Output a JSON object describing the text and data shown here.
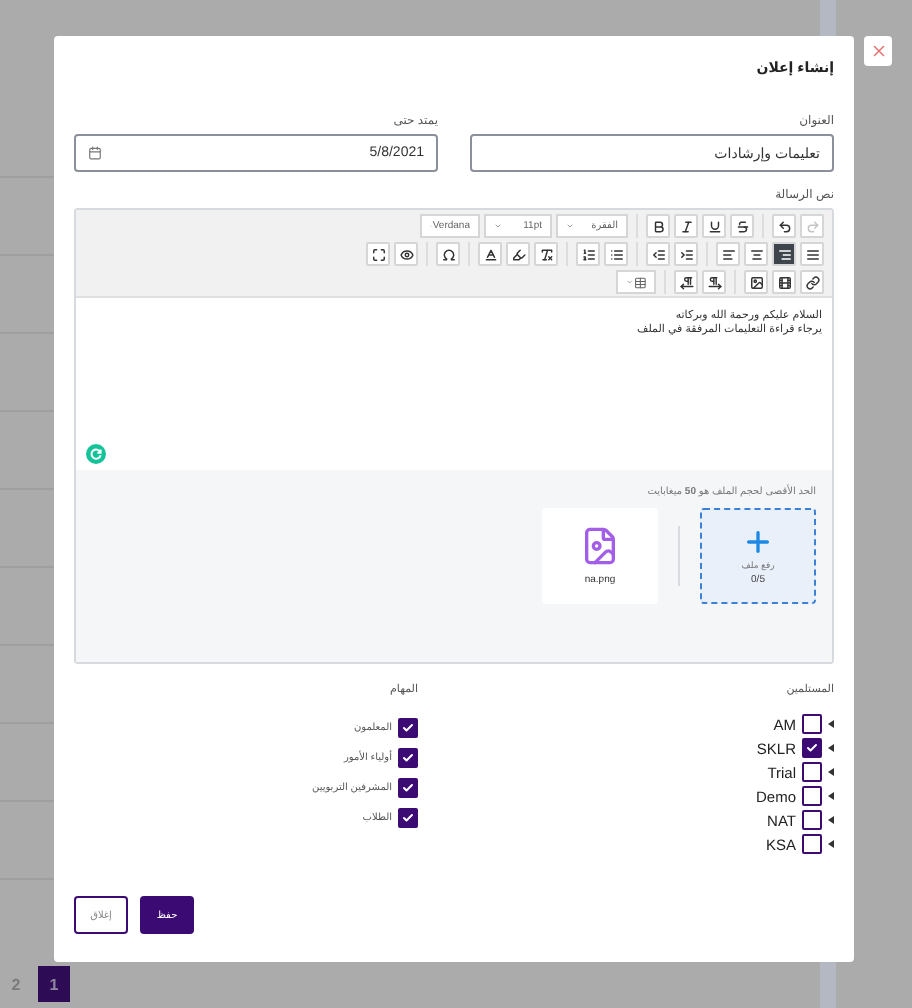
{
  "dialog": {
    "title": "إنشاء إعلان"
  },
  "fields": [
    {
      "label": "العنوان",
      "value": "تعليمات وإرشادات",
      "kind": "text"
    },
    {
      "label": "يمتد حتى",
      "value": "5/8/2021",
      "kind": "date"
    }
  ],
  "message": {
    "label": "نص الرسالة",
    "toolbar": [
      [
        {
          "kind": "redo",
          "disabled": true
        },
        {
          "kind": "undo"
        },
        {
          "kind": "sep"
        },
        {
          "kind": "strike"
        },
        {
          "kind": "underline"
        },
        {
          "kind": "italic"
        },
        {
          "kind": "bold"
        },
        {
          "kind": "sep"
        },
        {
          "kind": "select",
          "value": "الفقرة"
        },
        {
          "kind": "select",
          "value": "11pt"
        },
        {
          "kind": "select",
          "value": "Verdana"
        }
      ],
      [
        {
          "kind": "justify",
          "selected": false
        },
        {
          "kind": "alignright",
          "selected": true
        },
        {
          "kind": "aligncenter",
          "selected": false
        },
        {
          "kind": "alignleft",
          "selected": false
        },
        {
          "kind": "sep"
        },
        {
          "kind": "indent"
        },
        {
          "kind": "outdent"
        },
        {
          "kind": "sep"
        },
        {
          "kind": "ulist"
        },
        {
          "kind": "olist"
        },
        {
          "kind": "sep"
        },
        {
          "kind": "clearformat"
        },
        {
          "kind": "highlight"
        },
        {
          "kind": "fontcolor"
        },
        {
          "kind": "sep"
        },
        {
          "kind": "omega"
        },
        {
          "kind": "sep"
        },
        {
          "kind": "preview"
        },
        {
          "kind": "fullscreen"
        }
      ],
      [
        {
          "kind": "link"
        },
        {
          "kind": "video"
        },
        {
          "kind": "image"
        },
        {
          "kind": "sep"
        },
        {
          "kind": "rtl"
        },
        {
          "kind": "ltr"
        },
        {
          "kind": "sep"
        },
        {
          "kind": "table"
        }
      ]
    ],
    "lines": [
      "السلام عليكم ورحمة الله وبركاته",
      "يرجاء قراءة التعليمات المرفقة في الملف"
    ],
    "upload": {
      "limit_note": "الحد الأقصى لحجم الملف هو **50** ميغابايت",
      "button_label": "رفع ملف",
      "count": "0/5",
      "files": [
        {
          "name": "na.png"
        }
      ]
    }
  },
  "recipients": {
    "label": "المستلمين",
    "items": [
      {
        "name": "AM",
        "checked": false
      },
      {
        "name": "SKLR",
        "checked": true
      },
      {
        "name": "Trial",
        "checked": false
      },
      {
        "name": "Demo",
        "checked": false
      },
      {
        "name": "NAT",
        "checked": false
      },
      {
        "name": "KSA",
        "checked": false
      }
    ]
  },
  "roles": {
    "label": "المهام",
    "items": [
      {
        "name": "المعلمون",
        "checked": true
      },
      {
        "name": "أولياء الأمور",
        "checked": true
      },
      {
        "name": "المشرفين التربويين",
        "checked": true
      },
      {
        "name": "الطلاب",
        "checked": true
      }
    ]
  },
  "buttons": [
    {
      "label": "حفظ",
      "kind": "primary"
    },
    {
      "label": "إغلاق",
      "kind": "secondary"
    }
  ],
  "pagination": [
    {
      "label": "1",
      "selected": true
    },
    {
      "label": "2",
      "selected": false
    }
  ]
}
